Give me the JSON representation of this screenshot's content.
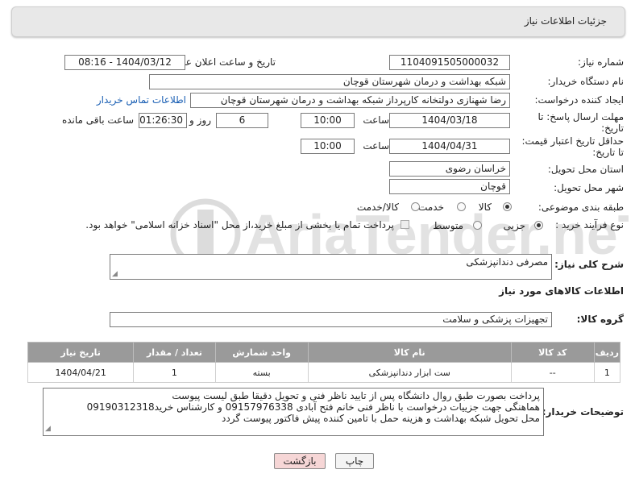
{
  "header": {
    "title": "جزئیات اطلاعات نیاز"
  },
  "fields": {
    "need_number_label": "شماره نیاز:",
    "need_number": "1104091505000032",
    "announce_label": "تاریخ و ساعت اعلان عمومی:",
    "announce_value": "1404/03/12 - 08:16",
    "buyer_org_label": "نام دستگاه خریدار:",
    "buyer_org": "شبکه بهداشت و درمان شهرستان قوچان",
    "creator_label": "ایجاد کننده درخواست:",
    "creator": "رضا شهنازی دولتخانه کارپرداز شبکه بهداشت و درمان شهرستان قوچان",
    "contact_link": "اطلاعات تماس خریدار",
    "deadline_label_1": "مهلت ارسال پاسخ: تا",
    "deadline_label_2": "تاریخ:",
    "deadline_date": "1404/03/18",
    "time_label": "ساعت",
    "deadline_time": "10:00",
    "days_value": "6",
    "days_label": "روز و",
    "remaining_value": "01:26:30",
    "remaining_label": "ساعت باقی مانده",
    "validity_label_1": "حداقل تاریخ اعتبار قیمت:",
    "validity_label_2": "تا تاریخ:",
    "validity_date": "1404/04/31",
    "validity_time": "10:00",
    "province_label": "استان محل تحویل:",
    "province": "خراسان رضوی",
    "city_label": "شهر محل تحویل:",
    "city": "قوچان",
    "category_label": "طبقه بندی موضوعی:",
    "category_options": [
      "کالا",
      "خدمت",
      "کالا/خدمت"
    ],
    "category_selected": "کالا",
    "process_label": "نوع فرآیند خرید :",
    "process_options": [
      "جزیی",
      "متوسط"
    ],
    "process_selected": "جزیی",
    "payment_note": "پرداخت تمام یا بخشی از مبلغ خرید،از محل \"اسناد خزانه اسلامی\" خواهد بود."
  },
  "description": {
    "label": "شرح کلی نیاز:",
    "value": "مصرفی دندانپزشکی"
  },
  "items_section": {
    "title": "اطلاعات کالاهای مورد نیاز",
    "group_label": "گروه کالا:",
    "group_value": "تجهیزات پزشکی و سلامت",
    "columns": [
      "ردیف",
      "کد کالا",
      "نام کالا",
      "واحد شمارش",
      "تعداد / مقدار",
      "تاریخ نیاز"
    ],
    "rows": [
      [
        "1",
        "--",
        "ست ابزار دندانپزشکی",
        "بسته",
        "1",
        "1404/04/21"
      ]
    ]
  },
  "buyer_notes": {
    "label": "توضیحات خریدار:",
    "lines": [
      "پرداخت بصورت طبق روال دانشگاه پس از تایید ناظر فنی و تحویل دقیقا طبق لیست پیوست",
      "هماهنگی جهت جزییات درخواست با ناظر فنی خانم فتح آبادی 09157976338 و کارشناس خرید09190312318",
      "محل تحویل شبکه بهداشت و هزینه حمل با تامین کننده پیش فاکتور پیوست گردد"
    ]
  },
  "buttons": {
    "print": "چاپ",
    "back": "بازگشت"
  },
  "watermark_text": "AriaTender.neT",
  "colors": {
    "accent_link": "#1a5fb4",
    "table_header": "#9a9a9a",
    "back_button": "#f6d6d6",
    "watermark": "#d9d9d9"
  }
}
